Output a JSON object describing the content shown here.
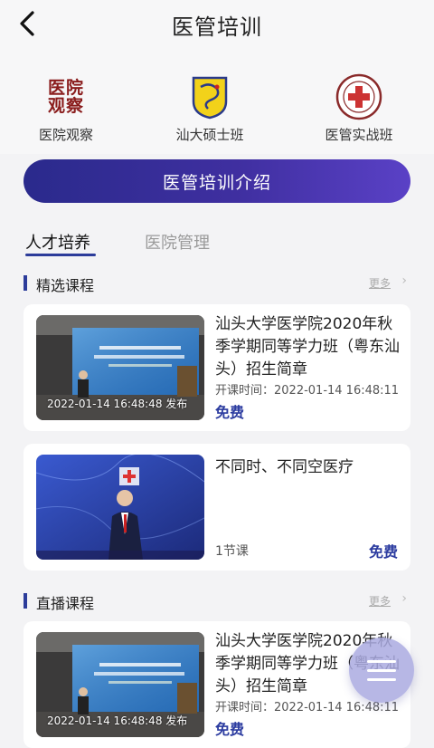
{
  "header": {
    "title": "医管培训",
    "back_icon": "back-arrow-icon"
  },
  "shortcuts": [
    {
      "label": "医院观察",
      "logo_text": "医院观察",
      "icon": "hospital-observation-logo"
    },
    {
      "label": "汕大硕士班",
      "icon": "stu-masters-emblem"
    },
    {
      "label": "医管实战班",
      "icon": "hospital-management-seal"
    }
  ],
  "intro_button": {
    "label": "医管培训介绍"
  },
  "tabs": [
    {
      "label": "人才培养",
      "active": true
    },
    {
      "label": "医院管理",
      "active": false
    }
  ],
  "sections": {
    "featured": {
      "title": "精选课程",
      "more": "更多"
    },
    "live": {
      "title": "直播课程",
      "more": "更多"
    }
  },
  "cards": {
    "featured_1": {
      "title": "汕头大学医学院2020年秋季学期同等学力班（粤东汕头）招生简章",
      "thumb_caption": "2022-01-14 16:48:48 发布",
      "meta": "开课时间：2022-01-14 16:48:11",
      "price": "免费"
    },
    "featured_2": {
      "title": "不同时、不同空医疗",
      "lessons": "1节课",
      "price": "免费"
    },
    "live_1": {
      "title": "汕头大学医学院2020年秋季学期同等学力班（粤东汕头）招生简章",
      "thumb_caption": "2022-01-14 16:48:48 发布",
      "meta": "开课时间：2022-01-14 16:48:11",
      "price": "免费"
    }
  },
  "fab": {
    "icon": "menu-icon"
  },
  "colors": {
    "accent": "#2c3c9a",
    "button_start": "#2a2a8c",
    "button_end": "#5a41c6"
  }
}
